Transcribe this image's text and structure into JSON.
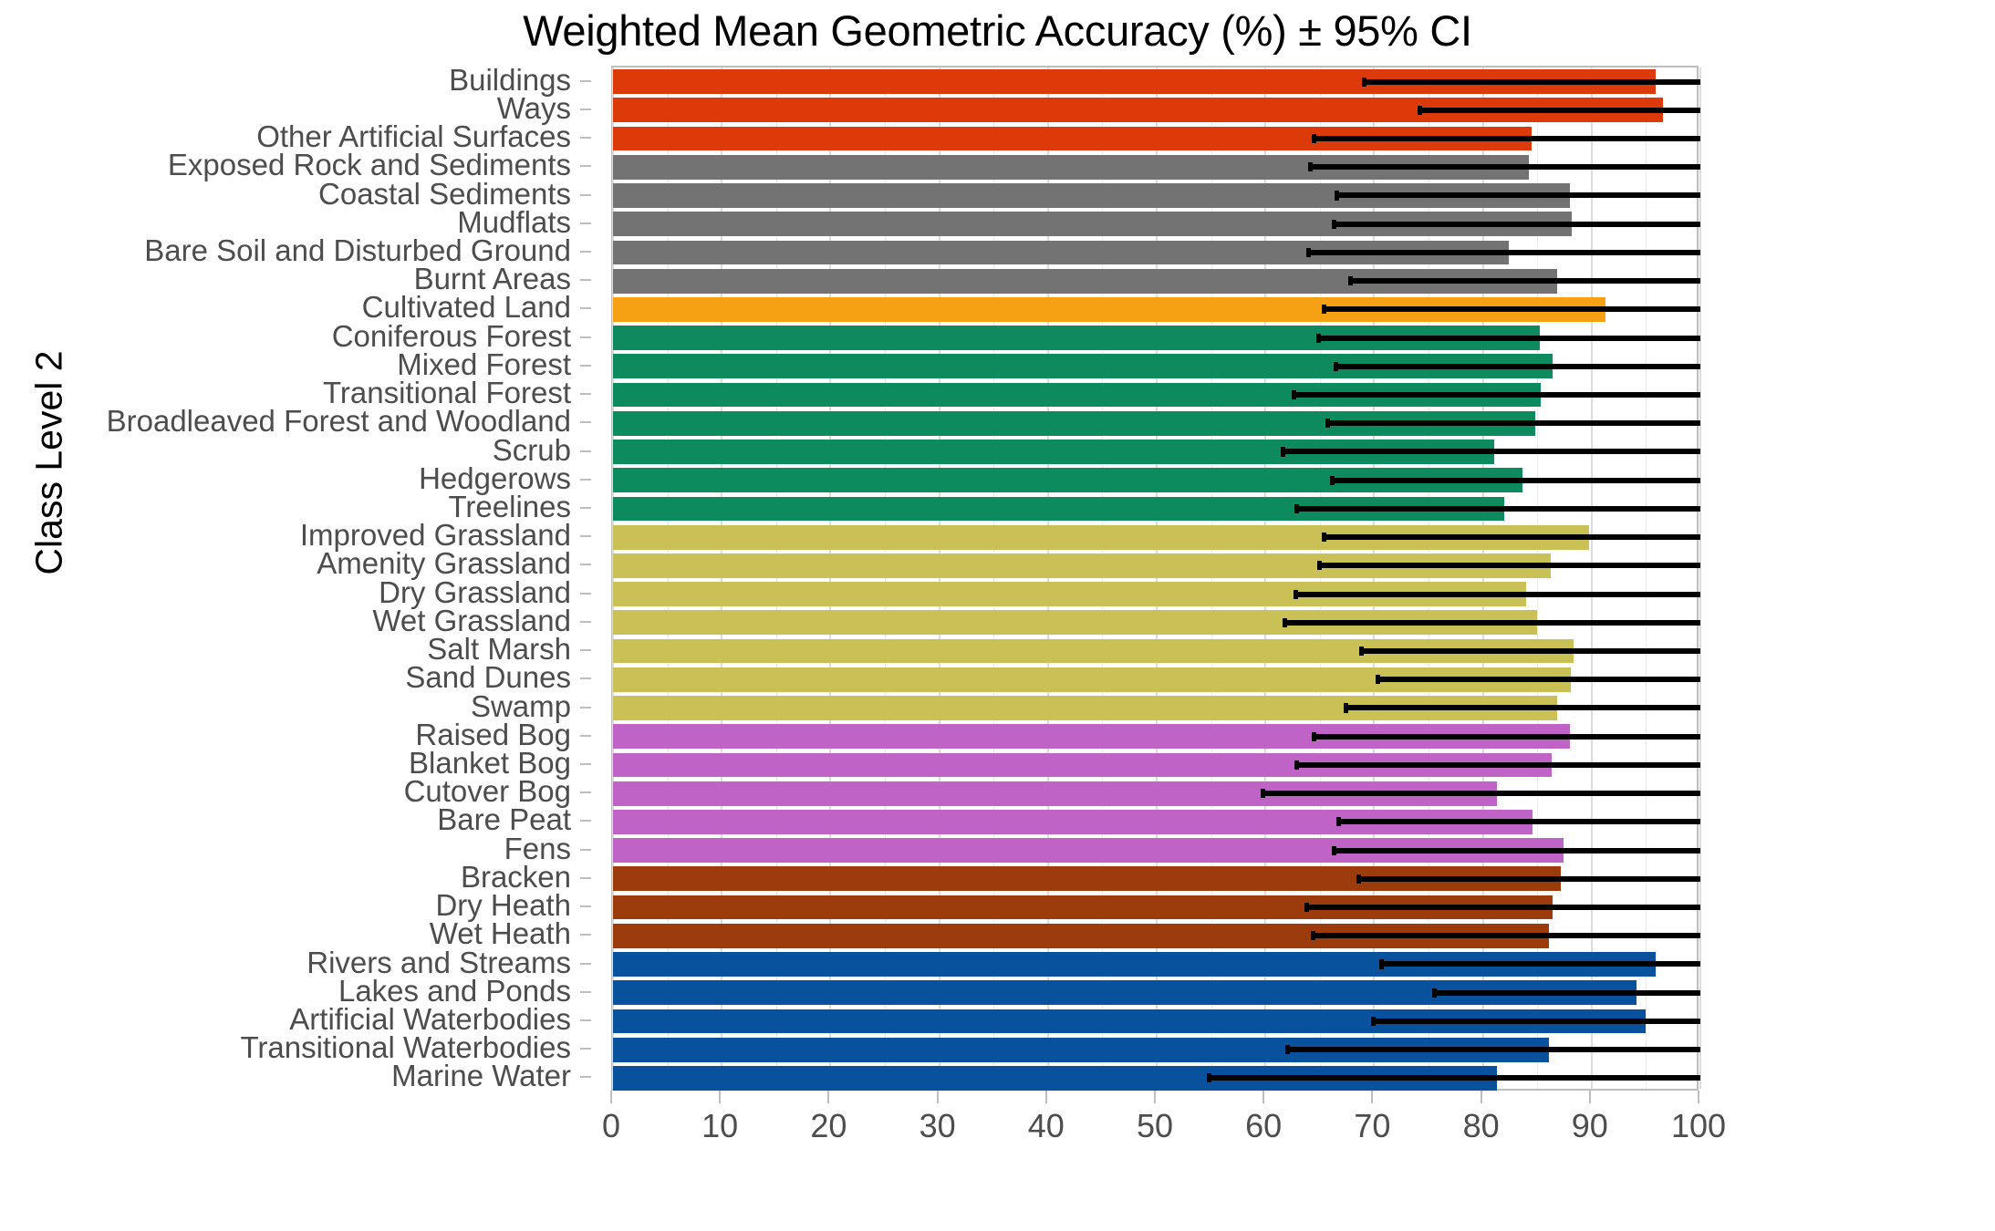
{
  "chart_data": {
    "type": "bar",
    "orientation": "horizontal",
    "title": "Weighted Mean Geometric Accuracy (%) ± 95% CI",
    "xlabel": "",
    "ylabel": "Class Level 2",
    "xlim": [
      0,
      100
    ],
    "x_ticks": [
      0,
      10,
      20,
      30,
      40,
      50,
      60,
      70,
      80,
      90,
      100
    ],
    "x_tick_labels": [
      "0",
      "10",
      "20",
      "30",
      "40",
      "50",
      "60",
      "70",
      "80",
      "90",
      "100"
    ],
    "grid": "vertical-only",
    "legend": "none",
    "error_bar_note": "95% confidence interval; upper bounds are clipped at 100",
    "group_colors": {
      "artificial_surfaces": "#DD3A0A",
      "bare_surfaces": "#737373",
      "cultivated": "#F5A113",
      "forest_and_scrub": "#0E8A5F",
      "grassland_and_marsh": "#C9C155",
      "peatland": "#BF63C6",
      "heath_and_bracken": "#9C3B0C",
      "water": "#08519C"
    },
    "categories": [
      "Buildings",
      "Ways",
      "Other Artificial Surfaces",
      "Exposed Rock and Sediments",
      "Coastal Sediments",
      "Mudflats",
      "Bare Soil and Disturbed Ground",
      "Burnt Areas",
      "Cultivated Land",
      "Coniferous Forest",
      "Mixed Forest",
      "Transitional Forest",
      "Broadleaved Forest and Woodland",
      "Scrub",
      "Hedgerows",
      "Treelines",
      "Improved Grassland",
      "Amenity Grassland",
      "Dry Grassland",
      "Wet Grassland",
      "Salt Marsh",
      "Sand Dunes",
      "Swamp",
      "Raised Bog",
      "Blanket Bog",
      "Cutover Bog",
      "Bare Peat",
      "Fens",
      "Bracken",
      "Dry Heath",
      "Wet Heath",
      "Rivers and Streams",
      "Lakes and Ponds",
      "Artificial Waterbodies",
      "Transitional Waterbodies",
      "Marine Water"
    ],
    "values": [
      95.9,
      96.6,
      84.5,
      84.2,
      88.0,
      88.2,
      82.4,
      86.8,
      91.3,
      85.2,
      86.4,
      85.3,
      84.8,
      81.0,
      83.6,
      82.0,
      89.8,
      86.2,
      84.0,
      85.0,
      88.3,
      88.1,
      86.8,
      88.0,
      86.3,
      81.3,
      84.6,
      87.4,
      87.2,
      86.4,
      86.1,
      95.9,
      94.1,
      95.0,
      86.1,
      81.3
    ],
    "ci_lower": [
      68.9,
      74.0,
      64.3,
      63.9,
      66.4,
      66.1,
      63.8,
      67.6,
      65.2,
      64.7,
      66.3,
      62.4,
      65.5,
      61.4,
      65.9,
      62.7,
      65.2,
      64.8,
      62.6,
      61.6,
      68.6,
      70.1,
      67.2,
      64.3,
      62.7,
      59.6,
      66.5,
      66.1,
      68.4,
      63.6,
      64.2,
      70.5,
      75.3,
      69.7,
      61.8,
      54.6
    ],
    "ci_upper": [
      100,
      100,
      100,
      100,
      100,
      100,
      100,
      100,
      100,
      100,
      100,
      100,
      100,
      100,
      100,
      100,
      100,
      100,
      100,
      100,
      100,
      100,
      100,
      100,
      100,
      100,
      100,
      100,
      100,
      100,
      100,
      100,
      100,
      100,
      100,
      100
    ],
    "colors": [
      "#DD3A0A",
      "#DD3A0A",
      "#DD3A0A",
      "#737373",
      "#737373",
      "#737373",
      "#737373",
      "#737373",
      "#F5A113",
      "#0E8A5F",
      "#0E8A5F",
      "#0E8A5F",
      "#0E8A5F",
      "#0E8A5F",
      "#0E8A5F",
      "#0E8A5F",
      "#C9C155",
      "#C9C155",
      "#C9C155",
      "#C9C155",
      "#C9C155",
      "#C9C155",
      "#C9C155",
      "#BF63C6",
      "#BF63C6",
      "#BF63C6",
      "#BF63C6",
      "#BF63C6",
      "#9C3B0C",
      "#9C3B0C",
      "#9C3B0C",
      "#08519C",
      "#08519C",
      "#08519C",
      "#08519C",
      "#08519C"
    ]
  }
}
